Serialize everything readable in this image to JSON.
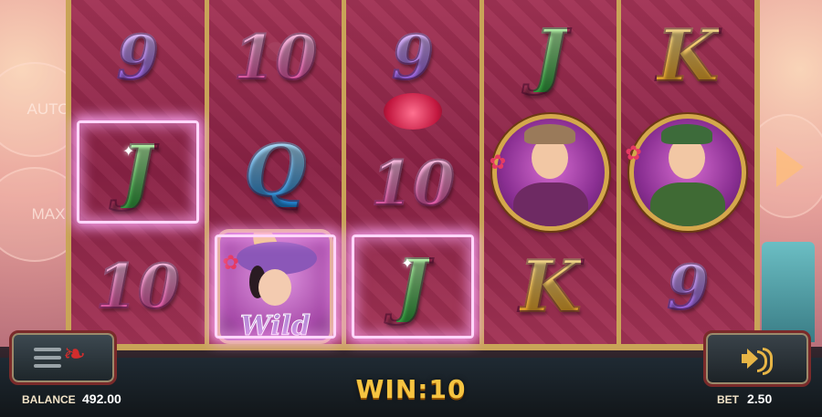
{
  "buttons": {
    "auto_label": "AUTO",
    "max_label": "MAX"
  },
  "reels": [
    [
      "9",
      "J",
      "10"
    ],
    [
      "10",
      "Q",
      "Wild"
    ],
    [
      "9",
      "10",
      "J"
    ],
    [
      "J",
      "character",
      "K"
    ],
    [
      "K",
      "character",
      "9"
    ]
  ],
  "winning_cells": [
    "reel1-row2",
    "reel2-row3",
    "reel3-row3"
  ],
  "wild_label": "Wild",
  "status": {
    "win_text": "WIN:10",
    "balance_label": "BALANCE",
    "balance_value": "492.00",
    "bet_label": "BET",
    "bet_value": "2.50"
  },
  "colors": {
    "reel_bg": "#8a2245",
    "frame_gold": "#c9a458",
    "win_text": "#f6c441"
  }
}
